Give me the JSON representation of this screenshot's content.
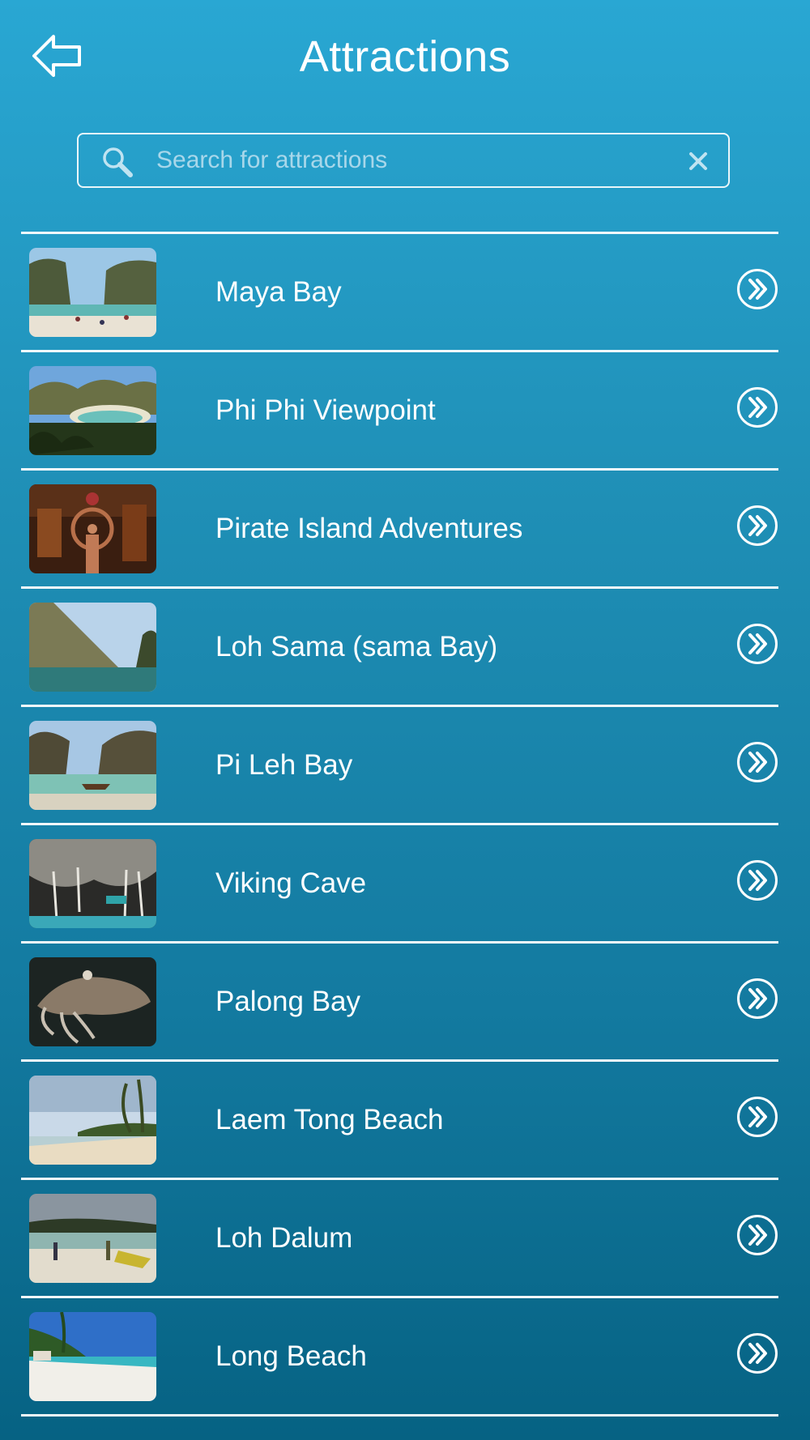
{
  "header": {
    "title": "Attractions",
    "back_icon": "back-arrow-icon"
  },
  "search": {
    "placeholder": "Search for attractions",
    "value": "",
    "icon": "search-icon",
    "clear_icon": "clear-icon"
  },
  "attractions": [
    {
      "label": "Maya Bay",
      "thumb": "maya-bay-photo"
    },
    {
      "label": "Phi Phi Viewpoint",
      "thumb": "phi-phi-viewpoint-photo"
    },
    {
      "label": "Pirate Island Adventures",
      "thumb": "pirate-island-photo"
    },
    {
      "label": "Loh Sama (sama Bay)",
      "thumb": "loh-sama-photo"
    },
    {
      "label": "Pi Leh Bay",
      "thumb": "pi-leh-bay-photo"
    },
    {
      "label": "Viking Cave",
      "thumb": "viking-cave-photo"
    },
    {
      "label": "Palong Bay",
      "thumb": "palong-bay-photo"
    },
    {
      "label": "Laem Tong Beach",
      "thumb": "laem-tong-beach-photo"
    },
    {
      "label": "Loh Dalum",
      "thumb": "loh-dalum-photo"
    },
    {
      "label": "Long Beach",
      "thumb": "long-beach-photo"
    }
  ],
  "colors": {
    "background_top": "#29a7d3",
    "background_bottom": "#066283",
    "foreground": "#ffffff"
  }
}
